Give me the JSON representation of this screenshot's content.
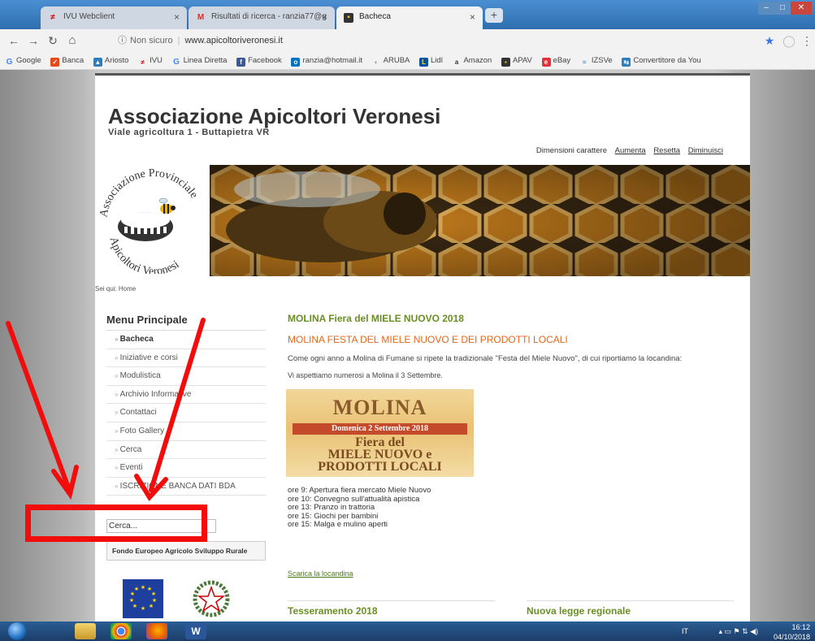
{
  "browser": {
    "tabs": [
      {
        "label": "IVU Webclient",
        "active": false
      },
      {
        "label": "Risultati di ricerca - ranzia77@g",
        "active": false
      },
      {
        "label": "Bacheca",
        "active": true
      }
    ],
    "address": {
      "security": "Non sicuro",
      "url": "www.apicoltoriveronesi.it"
    },
    "bookmarks": [
      "Google",
      "Banca",
      "Ariosto",
      "IVU",
      "Linea Diretta",
      "Facebook",
      "ranzia@hotmail.it",
      "ARUBA",
      "Lidl",
      "Amazon",
      "APAV",
      "eBay",
      "IZSVe",
      "Convertitore da You"
    ]
  },
  "site": {
    "title": "Associazione Apicoltori Veronesi",
    "subtitle": "Viale agricoltura 1 - Buttapietra VR",
    "font_controls": {
      "label": "Dimensioni carattere",
      "increase": "Aumenta",
      "reset": "Resetta",
      "decrease": "Diminuisci"
    },
    "logo_text": {
      "top": "Associazione Provinciale",
      "bottom": "Apicoltori Veronesi"
    },
    "breadcrumb": "Sei qui: Home",
    "menu": {
      "title": "Menu Principale",
      "items": [
        "Bacheca",
        "Iniziative e corsi",
        "Modulistica",
        "Archivio Informative",
        "Contattaci",
        "Foto Gallery",
        "Cerca",
        "Eventi",
        "ISCRIZIONE BANCA DATI BDA"
      ]
    },
    "search": {
      "placeholder": "Cerca..."
    },
    "fondo": "Fondo Europeo Agricolo Sviluppo Rurale",
    "article": {
      "heading": "MOLINA Fiera del MIELE NUOVO 2018",
      "subheading": "MOLINA FESTA DEL MIELE NUOVO E DEI PRODOTTI LOCALI",
      "p1": "Come ogni anno a Molina di Fumane si ripete la tradizionale \"Festa del Miele Nuovo\", di cui riportiamo la locandina:",
      "p2": "Vi aspettiamo numerosi a Molina il 3 Settembre.",
      "poster": {
        "town": "MOLINA",
        "date": "Domenica 2 Settembre 2018",
        "line1": "Fiera del",
        "line2": "MIELE NUOVO e",
        "line3": "PRODOTTI LOCALI"
      },
      "schedule": [
        "ore  9: Apertura fiera mercato Miele Nuovo",
        "ore 10: Convegno sull'attualità apistica",
        "ore 13: Pranzo in trattoria",
        "ore 15: Giochi per bambini",
        "ore 15: Malga e mulino aperti"
      ],
      "download": "Scarica la locandina"
    },
    "sections": {
      "left": "Tesseramento 2018",
      "right": "Nuova legge regionale"
    }
  },
  "taskbar": {
    "lang": "IT",
    "time": "16:12",
    "date": "04/10/2018"
  },
  "colors": {
    "annotation": "#f20d0d",
    "heading_green": "#6a8f22",
    "heading_orange": "#e8661a"
  }
}
